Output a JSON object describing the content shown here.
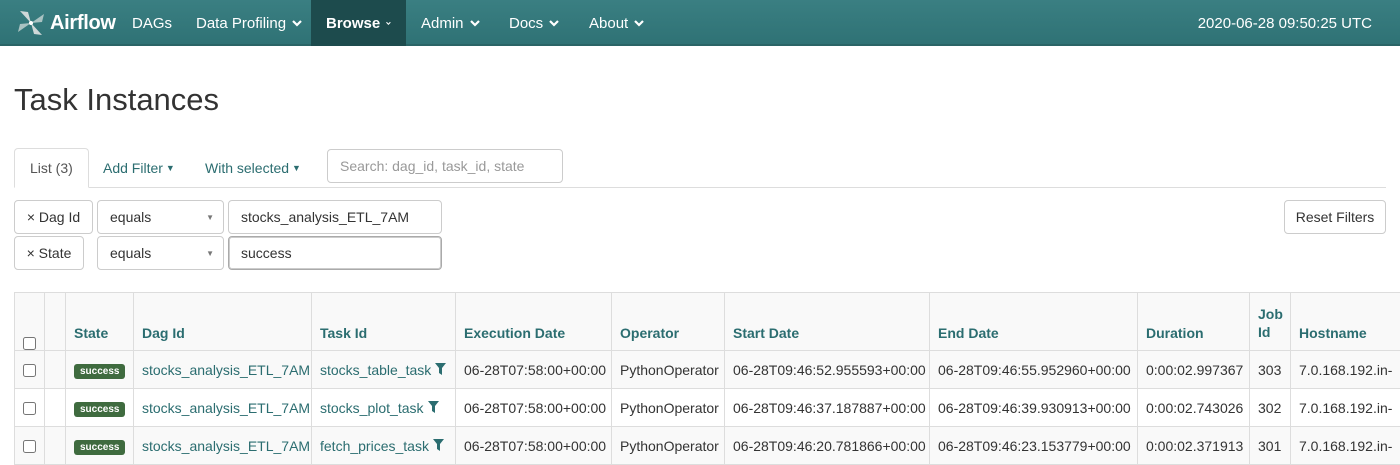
{
  "navbar": {
    "brand": "Airflow",
    "items": [
      {
        "label": "DAGs",
        "dropdown": false
      },
      {
        "label": "Data Profiling",
        "dropdown": true
      },
      {
        "label": "Browse",
        "dropdown": true,
        "active": true
      },
      {
        "label": "Admin",
        "dropdown": true
      },
      {
        "label": "Docs",
        "dropdown": true
      },
      {
        "label": "About",
        "dropdown": true
      }
    ],
    "clock": "2020-06-28 09:50:25 UTC",
    "colors": {
      "bar": "#33777a",
      "active": "#1d4b4d"
    }
  },
  "page": {
    "title": "Task Instances"
  },
  "tabs": {
    "list": "List (3)",
    "add_filter": "Add Filter",
    "with_selected": "With selected"
  },
  "search": {
    "placeholder": "Search: dag_id, task_id, state",
    "value": ""
  },
  "filters": [
    {
      "remove_label": "× Dag Id",
      "operator": "equals",
      "value": "stocks_analysis_ETL_7AM"
    },
    {
      "remove_label": "× State",
      "operator": "equals",
      "value": "success"
    }
  ],
  "reset_filters": "Reset Filters",
  "table": {
    "columns": [
      "State",
      "Dag Id",
      "Task Id",
      "Execution Date",
      "Operator",
      "Start Date",
      "End Date",
      "Duration",
      "Job Id",
      "Hostname"
    ],
    "job_id_lines": [
      "Job",
      "Id"
    ],
    "rows": [
      {
        "state": "success",
        "dag_id": "stocks_analysis_ETL_7AM",
        "task_id": "stocks_table_task",
        "execution_date": "06-28T07:58:00+00:00",
        "operator": "PythonOperator",
        "start_date": "06-28T09:46:52.955593+00:00",
        "end_date": "06-28T09:46:55.952960+00:00",
        "duration": "0:00:02.997367",
        "job_id": "303",
        "hostname": "7.0.168.192.in-"
      },
      {
        "state": "success",
        "dag_id": "stocks_analysis_ETL_7AM",
        "task_id": "stocks_plot_task",
        "execution_date": "06-28T07:58:00+00:00",
        "operator": "PythonOperator",
        "start_date": "06-28T09:46:37.187887+00:00",
        "end_date": "06-28T09:46:39.930913+00:00",
        "duration": "0:00:02.743026",
        "job_id": "302",
        "hostname": "7.0.168.192.in-"
      },
      {
        "state": "success",
        "dag_id": "stocks_analysis_ETL_7AM",
        "task_id": "fetch_prices_task",
        "execution_date": "06-28T07:58:00+00:00",
        "operator": "PythonOperator",
        "start_date": "06-28T09:46:20.781866+00:00",
        "end_date": "06-28T09:46:23.153779+00:00",
        "duration": "0:00:02.371913",
        "job_id": "301",
        "hostname": "7.0.168.192.in-"
      }
    ]
  },
  "colors": {
    "link": "#2b6d70",
    "success_badge": "#3f6b3f"
  }
}
